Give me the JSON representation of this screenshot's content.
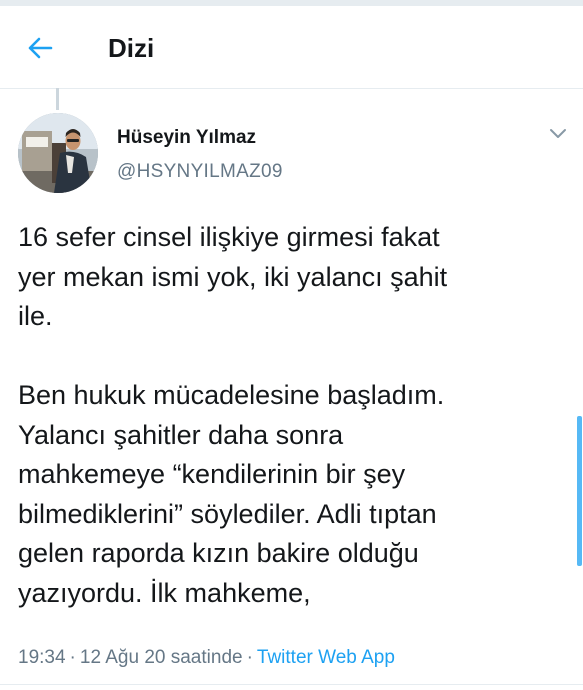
{
  "header": {
    "title": "Dizi",
    "back_icon": "arrow-left-icon",
    "accent_color": "#1da1f2"
  },
  "tweet": {
    "author_name": "Hüseyin Yılmaz",
    "author_handle": "@HSYNYILMAZ09",
    "caret_icon": "chevron-down-icon",
    "text": "16 sefer cinsel ilişkiye girmesi fakat\nyer mekan ismi yok, iki yalancı şahit\nile.\n\nBen hukuk mücadelesine başladım.\nYalancı şahitler daha sonra\nmahkemeye “kendilerinin bir şey\nbilmediklerini” söylediler. Adli tıptan\ngelen raporda kızın bakire olduğu\nyazıyordu. İlk mahkeme,",
    "time": "19:34",
    "separator": "·",
    "date": "12 Ağu 20 saatinde",
    "source": "Twitter Web App"
  },
  "colors": {
    "text_primary": "#14171a",
    "text_secondary": "#657786",
    "link": "#1da1f2",
    "divider": "#e6ecf0"
  }
}
